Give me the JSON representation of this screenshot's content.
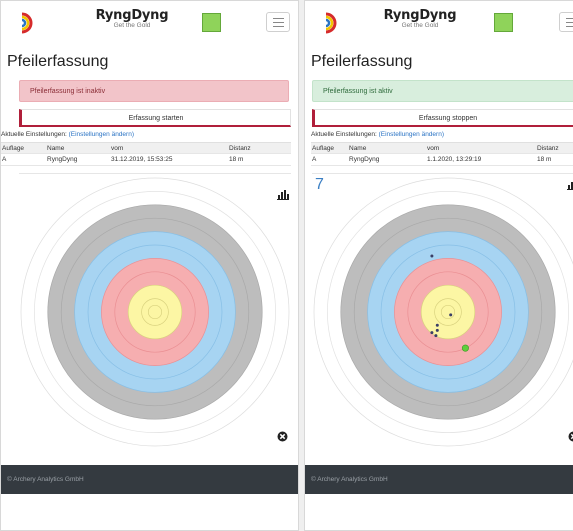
{
  "colors": {
    "status_square": "#8fd35a",
    "alert_danger_bg": "#f2c4c9",
    "alert_success_bg": "#d8eedd",
    "button_accent": "#b01f3a",
    "link": "#2a73c4",
    "footer_bg": "#343a40",
    "ring_white": "#ffffff",
    "ring_gray": "#bdbdbd",
    "ring_blue": "#a7d4f2",
    "ring_red": "#f6aeb0",
    "ring_yellow": "#fcf6a4",
    "arrow_hit_last": "#5fcf3c"
  },
  "icons": {
    "logo": "target-logo-icon",
    "menu": "hamburger-menu-icon",
    "statistics": "bar-chart-icon",
    "close": "close-circle-icon"
  },
  "panels": [
    {
      "brand": {
        "name": "Ryng🔘yng",
        "tagline": "Get the Gold"
      },
      "title": "Pfeilerfassung",
      "alert": "Pfeilerfassung ist inaktiv",
      "alert_type": "danger",
      "capture_button": "Erfassung starten",
      "settings_prefix": "Aktuelle Einstellungen:",
      "settings_link": "(Einstellungen ändern)",
      "table": {
        "headers": [
          "Auflage",
          "Name",
          "vom",
          "Distanz"
        ],
        "row": [
          "A",
          "RyngDyng",
          "31.12.2019, 15:53:25",
          "18 m"
        ]
      },
      "arrow_count": "",
      "hits": [],
      "footer": "© Archery Analytics GmbH"
    },
    {
      "brand": {
        "name": "Ryng🔘yng",
        "tagline": "Get the Gold"
      },
      "title": "Pfeilerfassung",
      "alert": "Pfeilerfassung ist aktiv",
      "alert_type": "success",
      "capture_button": "Erfassung stoppen",
      "settings_prefix": "Aktuelle Einstellungen:",
      "settings_link": "(Einstellungen ändern)",
      "table": {
        "headers": [
          "Auflage",
          "Name",
          "vom",
          "Distanz"
        ],
        "row": [
          "A",
          "RyngDyng",
          "1.1.2020, 13:29:19",
          "18 m"
        ]
      },
      "arrow_count": "7",
      "hits": [
        {
          "dx": -0.12,
          "dy": -0.76,
          "last": false
        },
        {
          "dx": 0.02,
          "dy": 0.04,
          "last": false
        },
        {
          "dx": -0.08,
          "dy": 0.18,
          "last": false
        },
        {
          "dx": -0.09,
          "dy": 0.32,
          "last": false
        },
        {
          "dx": -0.08,
          "dy": 0.25,
          "last": false
        },
        {
          "dx": -0.12,
          "dy": 0.28,
          "last": false
        },
        {
          "dx": 0.13,
          "dy": 0.49,
          "last": true
        }
      ],
      "footer": "© Archery Analytics GmbH"
    }
  ]
}
